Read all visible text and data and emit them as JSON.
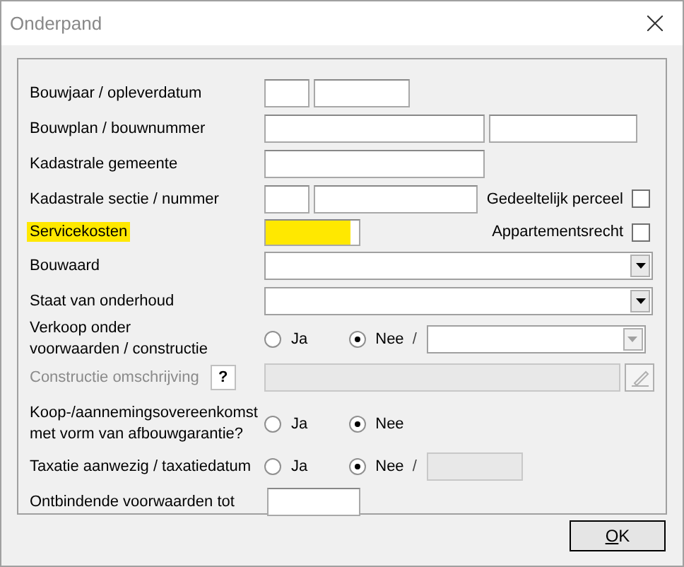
{
  "window": {
    "title": "Onderpand"
  },
  "bouwjaar": {
    "label": "Bouwjaar / opleverdatum"
  },
  "bouwplan": {
    "label": "Bouwplan / bouwnummer"
  },
  "gemeente": {
    "label": "Kadastrale gemeente"
  },
  "sectie": {
    "label": "Kadastrale sectie / nummer",
    "checkbox": {
      "label": "Gedeeltelijk perceel",
      "checked": false
    }
  },
  "servicekosten": {
    "label": "Servicekosten",
    "highlighted": true,
    "checkbox": {
      "label": "Appartementsrecht",
      "checked": false
    }
  },
  "bouwaard": {
    "label": "Bouwaard"
  },
  "staat": {
    "label": "Staat van onderhoud"
  },
  "verkoop": {
    "label": "Verkoop onder voorwaarden / constructie",
    "options": [
      {
        "label": "Ja",
        "selected": false
      },
      {
        "label": "Nee",
        "selected": true
      }
    ],
    "separator": "/",
    "combo_disabled": true
  },
  "constructie": {
    "label": "Constructie omschrijving",
    "help": "?",
    "disabled": true
  },
  "koop": {
    "label": "Koop-/aannemingsovereenkomst met vorm van afbouwgarantie?",
    "options": [
      {
        "label": "Ja",
        "selected": false
      },
      {
        "label": "Nee",
        "selected": true
      }
    ]
  },
  "taxatie": {
    "label": "Taxatie aanwezig / taxatiedatum",
    "options": [
      {
        "label": "Ja",
        "selected": false
      },
      {
        "label": "Nee",
        "selected": true
      }
    ],
    "separator": "/",
    "date_disabled": true
  },
  "ontbindende": {
    "label": "Ontbindende voorwaarden tot"
  },
  "ok_button": {
    "label": "OK"
  }
}
